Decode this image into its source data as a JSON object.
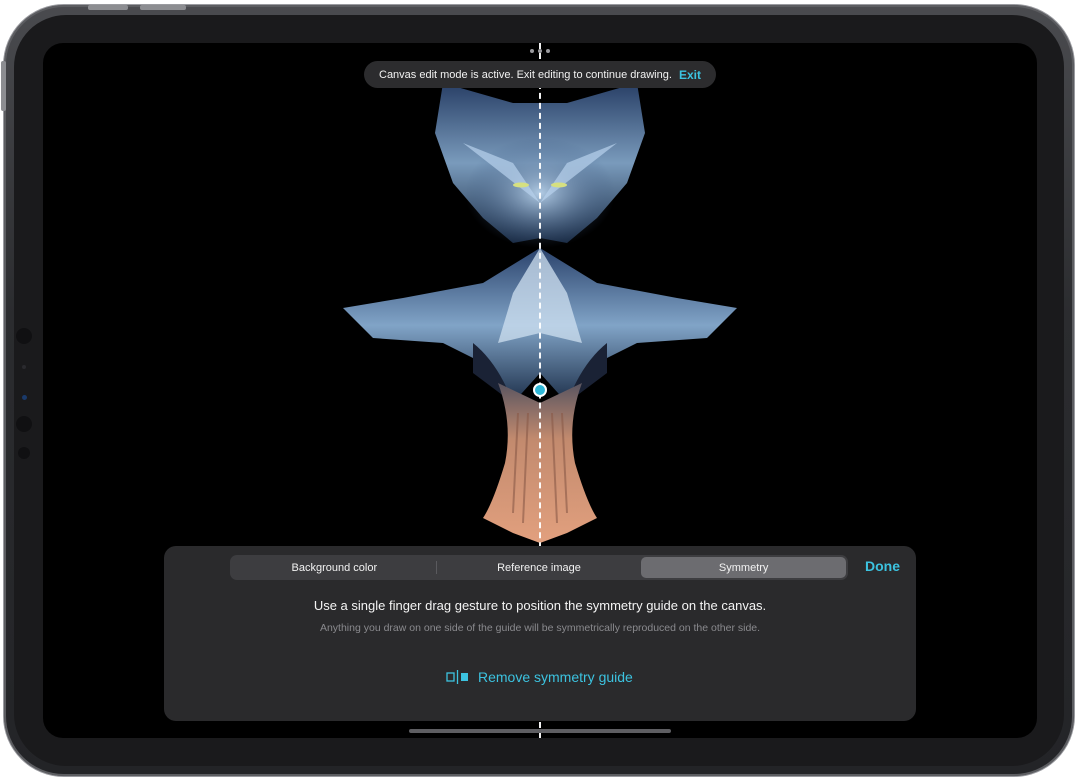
{
  "toast": {
    "message": "Canvas edit mode is active. Exit editing to continue drawing.",
    "exit_label": "Exit"
  },
  "tabs": [
    {
      "label": "Background color",
      "selected": false
    },
    {
      "label": "Reference image",
      "selected": false
    },
    {
      "label": "Symmetry",
      "selected": true
    }
  ],
  "done_label": "Done",
  "symmetry": {
    "headline": "Use a single finger drag gesture to position the symmetry guide on the canvas.",
    "subline": "Anything you draw on one side of the guide will be symmetrically reproduced on the other side.",
    "remove_label": "Remove symmetry guide",
    "remove_icon": "symmetry-guide-icon"
  },
  "colors": {
    "accent": "#3cc3e0",
    "panel": "#2a2a2c",
    "selected_tab": "#6c6c70",
    "canvas": "#000000"
  }
}
